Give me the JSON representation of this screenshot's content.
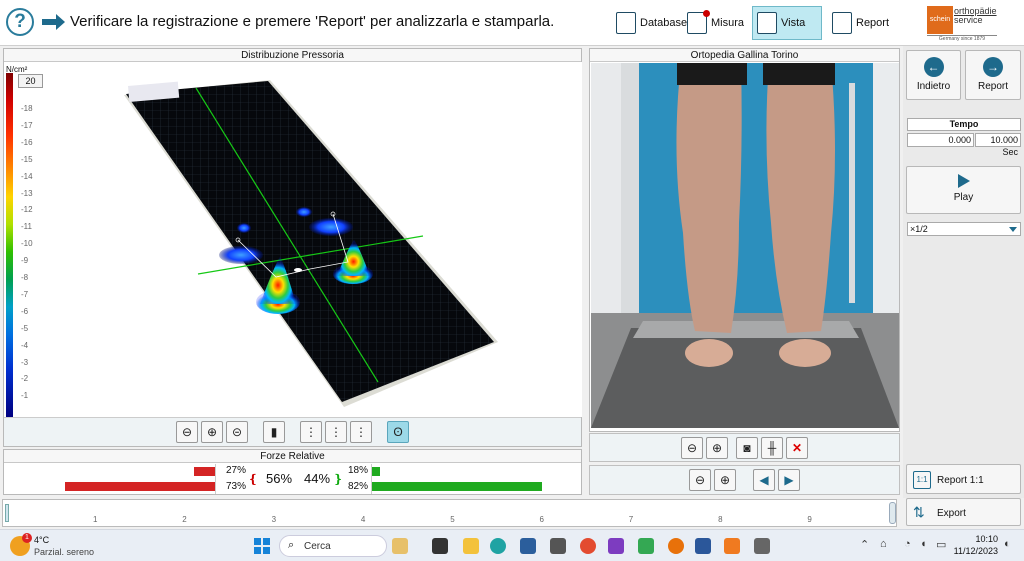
{
  "header": {
    "help_icon": "question-icon",
    "instruction": "Verificare la registrazione e premere 'Report' per analizzarla e stamparla.",
    "nav": [
      {
        "label": "Database",
        "icon": "database-icon"
      },
      {
        "label": "Misura",
        "icon": "measure-icon"
      },
      {
        "label": "Vista",
        "icon": "view-icon",
        "active": true
      },
      {
        "label": "Report",
        "icon": "report-icon"
      }
    ],
    "logo": {
      "brand": "schein",
      "line1": "orthopädie",
      "line2": "service",
      "tagline": "Germany since 1879"
    }
  },
  "pressure_panel": {
    "title": "Distribuzione Pressoria",
    "unit": "N/cm²",
    "scale_max": "20",
    "scale_ticks": [
      "18",
      "17",
      "16",
      "15",
      "14",
      "13",
      "12",
      "11",
      "10",
      "9",
      "8",
      "7",
      "6",
      "5",
      "4",
      "3",
      "2",
      "1"
    ]
  },
  "forze": {
    "title": "Forze Relative",
    "left_top_pct": "27%",
    "left_bottom_pct": "73%",
    "left_total": "56%",
    "right_total": "44%",
    "right_top_pct": "18%",
    "right_bottom_pct": "82%",
    "values": {
      "left_forefoot": 27,
      "left_heel": 73,
      "right_forefoot": 18,
      "right_heel": 82
    },
    "colors": {
      "left": "#d42424",
      "right": "#1faa1f"
    }
  },
  "video_panel": {
    "title": "Ortopedia Gallina Torino"
  },
  "right_column": {
    "back_label": "Indietro",
    "report_label": "Report",
    "tempo_title": "Tempo",
    "tempo_current": "0.000",
    "tempo_total": "10.000 Sec",
    "play_label": "Play",
    "speed": "×1/2",
    "report11_label": "Report 1:1",
    "export_label": "Export"
  },
  "timeline": {
    "labels": [
      "1",
      "2",
      "3",
      "4",
      "5",
      "6",
      "7",
      "8",
      "9"
    ]
  },
  "taskbar": {
    "weather_temp": "4°C",
    "weather_desc": "Parzial. sereno",
    "weather_badge": "1",
    "search_label": "Cerca",
    "time": "10:10",
    "date": "11/12/2023"
  }
}
